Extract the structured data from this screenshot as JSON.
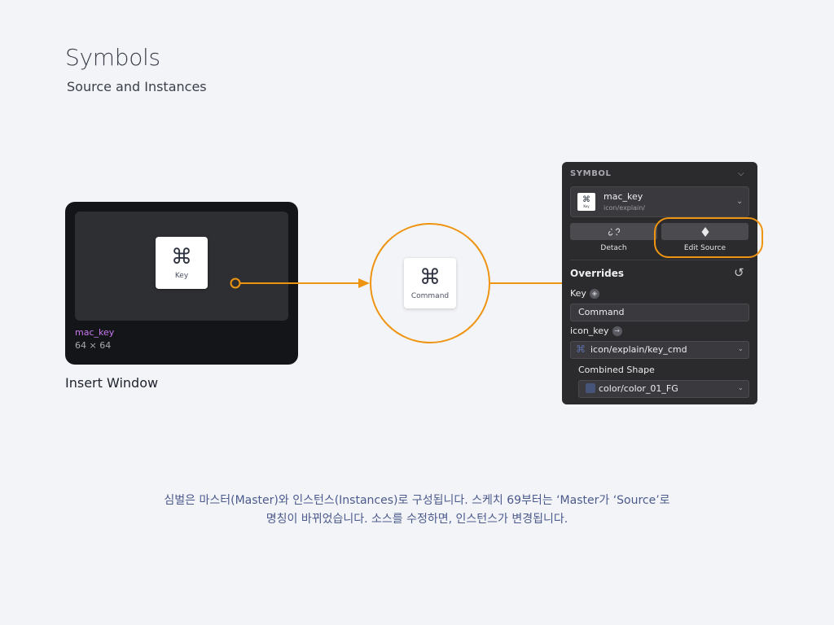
{
  "header": {
    "title": "Symbols",
    "subtitle": "Source and Instances"
  },
  "insert_window": {
    "key_glyph": "⌘",
    "key_label": "Key",
    "symbol_name": "mac_key",
    "symbol_size": "64 × 64",
    "caption": "Insert Window"
  },
  "instance": {
    "glyph": "⌘",
    "label": "Command"
  },
  "inspector": {
    "section_title": "SYMBOL",
    "symbol_name": "mac_key",
    "symbol_path": "icon/explain/",
    "thumb_glyph": "⌘",
    "thumb_label": "Key",
    "detach_label": "Detach",
    "edit_source_label": "Edit Source",
    "overrides_title": "Overrides",
    "key_label": "Key",
    "key_value": "Command",
    "icon_key_label": "icon_key",
    "icon_key_value": "icon/explain/key_cmd",
    "combined_shape_label": "Combined Shape",
    "combined_shape_value": "color/color_01_FG",
    "swatch_color": "#475479"
  },
  "accent_color": "#ef9410",
  "description": {
    "line1": "심벌은 마스터(Master)와 인스턴스(Instances)로 구성됩니다. 스케치 69부터는 ‘Master가 ‘Source’로",
    "line2": "명칭이 바뀌었습니다. 소스를 수정하면, 인스턴스가 변경됩니다."
  }
}
